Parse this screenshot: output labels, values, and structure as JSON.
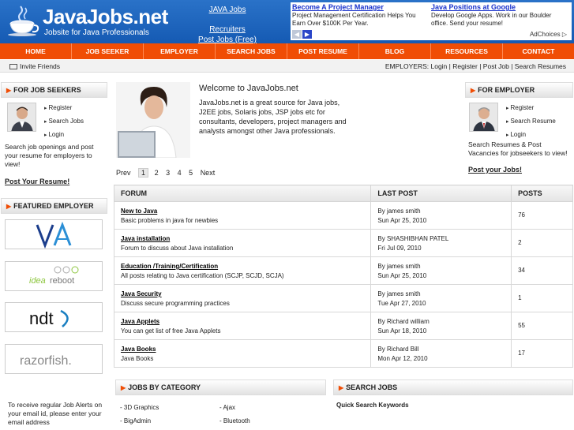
{
  "header": {
    "logo_text": "JavaJobs.net",
    "tagline": "Jobsite for Java Professionals",
    "link_java_jobs": "JAVA Jobs",
    "link_recruiters": "Recruiters",
    "link_post_jobs": "Post Jobs (Free)"
  },
  "ads": [
    {
      "title": "Become A Project Manager",
      "desc": "Project Management Certification Helps You Earn Over $100K Per Year."
    },
    {
      "title": "Java Positions at Google",
      "desc": "Develop Google Apps. Work in our Boulder office. Send your resume!"
    }
  ],
  "adchoices": "AdChoices ▷",
  "nav": [
    "HOME",
    "JOB SEEKER",
    "EMPLOYER",
    "SEARCH JOBS",
    "POST RESUME",
    "BLOG",
    "RESOURCES",
    "CONTACT"
  ],
  "subnav": {
    "invite": "Invite Friends",
    "employers": "EMPLOYERS: Login | Register | Post Job | Search Resumes"
  },
  "job_seekers": {
    "title": "FOR JOB SEEKERS",
    "links": [
      "Register",
      "Search Jobs",
      "Login"
    ],
    "text": "Search job openings and post your resume for employers to view!",
    "cta": "Post Your Resume!"
  },
  "employer": {
    "title": "FOR EMPLOYER",
    "links": [
      "Register",
      "Search Resume",
      "Login"
    ],
    "text": "Search Resumes & Post Vacancies for jobseekers to view!",
    "cta": "Post your Jobs!"
  },
  "featured": {
    "title": "FEATURED EMPLOYER",
    "logos": [
      "VA",
      "idea reboot",
      "ndt",
      "razorfish."
    ]
  },
  "alerts_text": "To receive regular Job Alerts on your email id, please enter your email address",
  "welcome": {
    "title": "Welcome to JavaJobs.net",
    "text": "JavaJobs.net is a great source for Java jobs, J2EE jobs, Solaris jobs, JSP jobs etc for consultants, developers, project managers and analysts amongst other Java professionals."
  },
  "pager": {
    "prev": "Prev",
    "pages": [
      "1",
      "2",
      "3",
      "4",
      "5"
    ],
    "next": "Next"
  },
  "forum": {
    "headers": [
      "FORUM",
      "LAST POST",
      "POSTS"
    ],
    "rows": [
      {
        "title": "New to Java",
        "desc": "Basic problems in java for newbies",
        "by": "By james smith",
        "date": "Sun Apr 25, 2010",
        "posts": "76"
      },
      {
        "title": "Java installation",
        "desc": "Forum to discuss about Java installation",
        "by": "By SHASHIBHAN PATEL",
        "date": "Fri Jul 09, 2010",
        "posts": "2"
      },
      {
        "title": "Education /Training/Certification",
        "desc": "All posts relating to Java certification (SCJP, SCJD, SCJA)",
        "by": "By james smith",
        "date": "Sun Apr 25, 2010",
        "posts": "34"
      },
      {
        "title": "Java Security",
        "desc": "Discuss secure programming practices",
        "by": "By james smith",
        "date": "Tue Apr 27, 2010",
        "posts": "1"
      },
      {
        "title": "Java Applets",
        "desc": "You can get list of free Java Applets",
        "by": "By Richard william",
        "date": "Sun Apr 18, 2010",
        "posts": "55"
      },
      {
        "title": "Java Books",
        "desc": "Java Books",
        "by": "By Richard Bill",
        "date": "Mon Apr 12, 2010",
        "posts": "17"
      }
    ]
  },
  "categories": {
    "title": "JOBS BY CATEGORY",
    "items": [
      "3D Graphics",
      "Ajax",
      "BigAdmin",
      "Bluetooth"
    ]
  },
  "search_jobs": {
    "title": "SEARCH JOBS",
    "label": "Quick Search Keywords"
  },
  "colors": {
    "brand_blue": "#1f66be",
    "nav_orange": "#f04d05"
  }
}
